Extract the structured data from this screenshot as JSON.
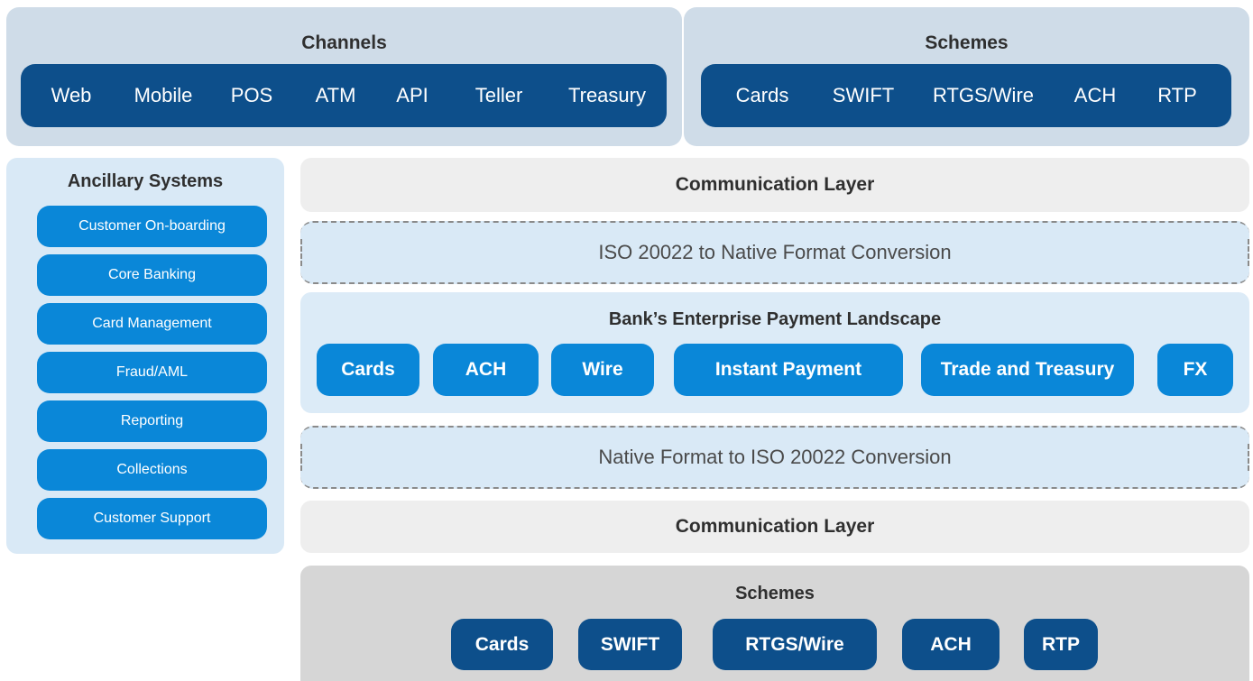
{
  "channels": {
    "title": "Channels",
    "items": [
      "Web",
      "Mobile",
      "POS",
      "ATM",
      "API",
      "Teller",
      "Treasury"
    ]
  },
  "schemes_top": {
    "title": "Schemes",
    "items": [
      "Cards",
      "SWIFT",
      "RTGS/Wire",
      "ACH",
      "RTP"
    ]
  },
  "ancillary": {
    "title": "Ancillary Systems",
    "items": [
      "Customer On-boarding",
      "Core Banking",
      "Card Management",
      "Fraud/AML",
      "Reporting",
      "Collections",
      "Customer Support"
    ]
  },
  "comm_layer_top": "Communication Layer",
  "iso_to_native": "ISO 20022 to Native Format Conversion",
  "landscape": {
    "title": "Bank’s Enterprise Payment Landscape",
    "items": [
      "Cards",
      "ACH",
      "Wire",
      "Instant Payment",
      "Trade and Treasury",
      "FX"
    ]
  },
  "native_to_iso": "Native Format to ISO 20022 Conversion",
  "comm_layer_bottom": "Communication Layer",
  "schemes_bottom": {
    "title": "Schemes",
    "items": [
      "Cards",
      "SWIFT",
      "RTGS/Wire",
      "ACH",
      "RTP"
    ]
  }
}
